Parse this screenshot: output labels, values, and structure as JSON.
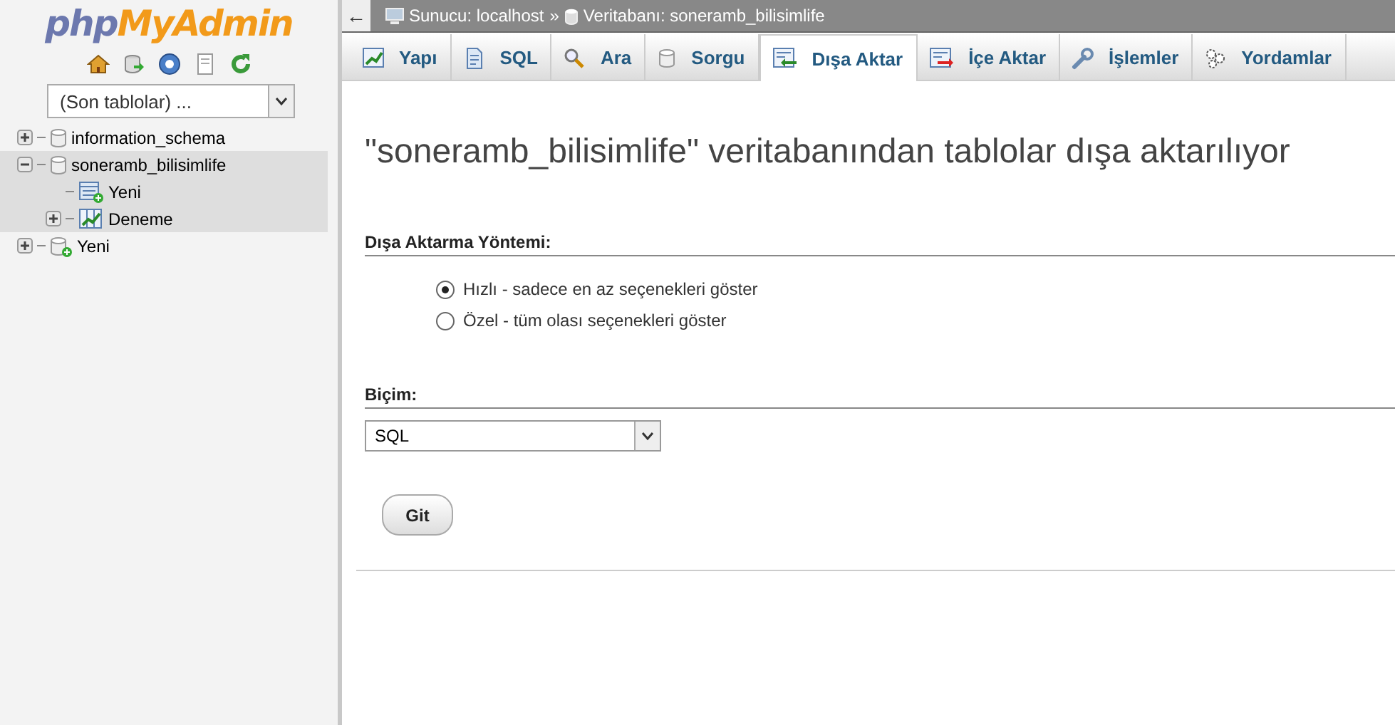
{
  "sidebar": {
    "logo": {
      "part_1": "php",
      "part_2": "MyAdmin"
    },
    "recent_tables": {
      "value": "(Son tablolar) ..."
    },
    "tree": [
      {
        "label": "information_schema",
        "kind": "database",
        "expanded": false,
        "selected": false
      },
      {
        "label": "soneramb_bilisimlife",
        "kind": "database",
        "expanded": true,
        "selected": true,
        "children": [
          {
            "label": "Yeni",
            "kind": "new_table",
            "selected": true
          },
          {
            "label": "Deneme",
            "kind": "table",
            "expanded": false,
            "selected": true
          }
        ]
      },
      {
        "label": "Yeni",
        "kind": "new_database",
        "expanded": false,
        "selected": false
      }
    ]
  },
  "breadcrumb": {
    "back": "←",
    "items": [
      {
        "label": "Sunucu: localhost",
        "kind": "server"
      },
      {
        "label": "Veritabanı: soneramb_bilisimlife",
        "kind": "database"
      }
    ],
    "separator": "»"
  },
  "tabs": [
    {
      "label": "Yapı",
      "selected": false
    },
    {
      "label": "SQL",
      "selected": false
    },
    {
      "label": "Ara",
      "selected": false
    },
    {
      "label": "Sorgu",
      "selected": false
    },
    {
      "label": "Dışa Aktar",
      "selected": true
    },
    {
      "label": "İçe Aktar",
      "selected": false
    },
    {
      "label": "İşlemler",
      "selected": false
    },
    {
      "label": "Yordamlar",
      "selected": false
    }
  ],
  "heading": "\"soneramb_bilisimlife\" veritabanından tablolar dışa aktarılıyor",
  "export_method": {
    "title": "Dışa Aktarma Yöntemi:",
    "options": [
      {
        "label": "Hızlı - sadece en az seçenekleri göster",
        "selected": true
      },
      {
        "label": "Özel - tüm olası seçenekleri göster",
        "selected": false
      }
    ]
  },
  "format": {
    "title": "Biçim:",
    "value": "SQL"
  },
  "go_button": "Git"
}
